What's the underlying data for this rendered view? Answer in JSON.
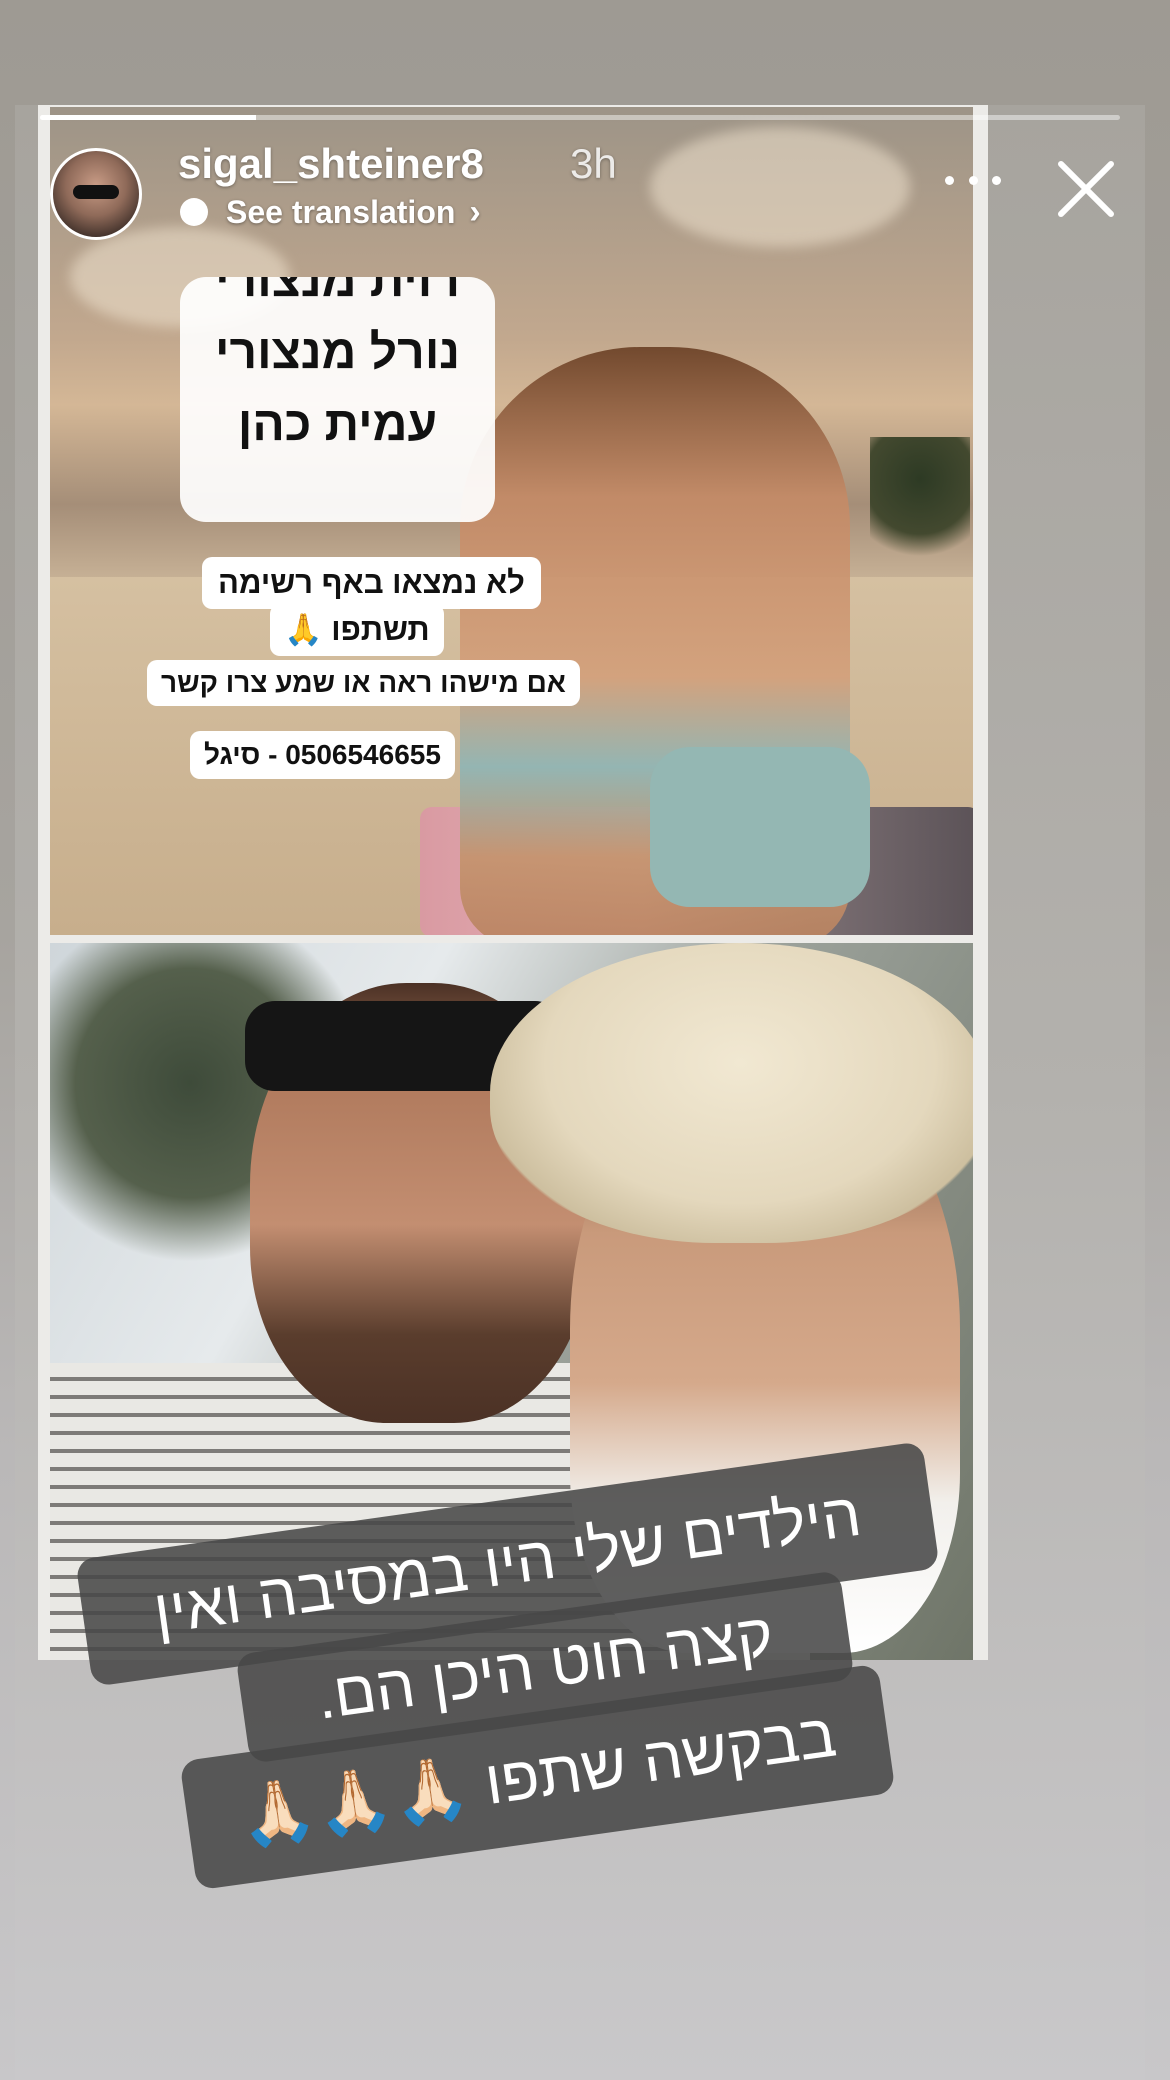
{
  "story": {
    "progress_fraction": 0.2
  },
  "header": {
    "username": "sigal_shteiner8",
    "timestamp": "3h",
    "translate_label": "See translation",
    "translate_chevron": "›",
    "more_icon": "more-horizontal-icon",
    "close_icon": "close-icon"
  },
  "flyer": {
    "names_line_cut": "רוית מנצורי",
    "names_line_1": "נורל מנצורי",
    "names_line_2": "עמית כהן",
    "notice_missing": "לא נמצאו באף רשימה",
    "notice_share": "תשתפו 🙏",
    "notice_contact": "אם מישהו ראה או שמע צרו קשר",
    "notice_phone": "0506546655 - סיגל"
  },
  "caption": {
    "line_1": "הילדים שלי היו במסיבה ואין",
    "line_2": "קצה חוט היכן הם.",
    "line_3": "בבקשה שתפו 🙏🏻🙏🏻🙏🏻"
  },
  "colors": {
    "caption_bg": "#484848",
    "header_text": "#ffffff"
  }
}
